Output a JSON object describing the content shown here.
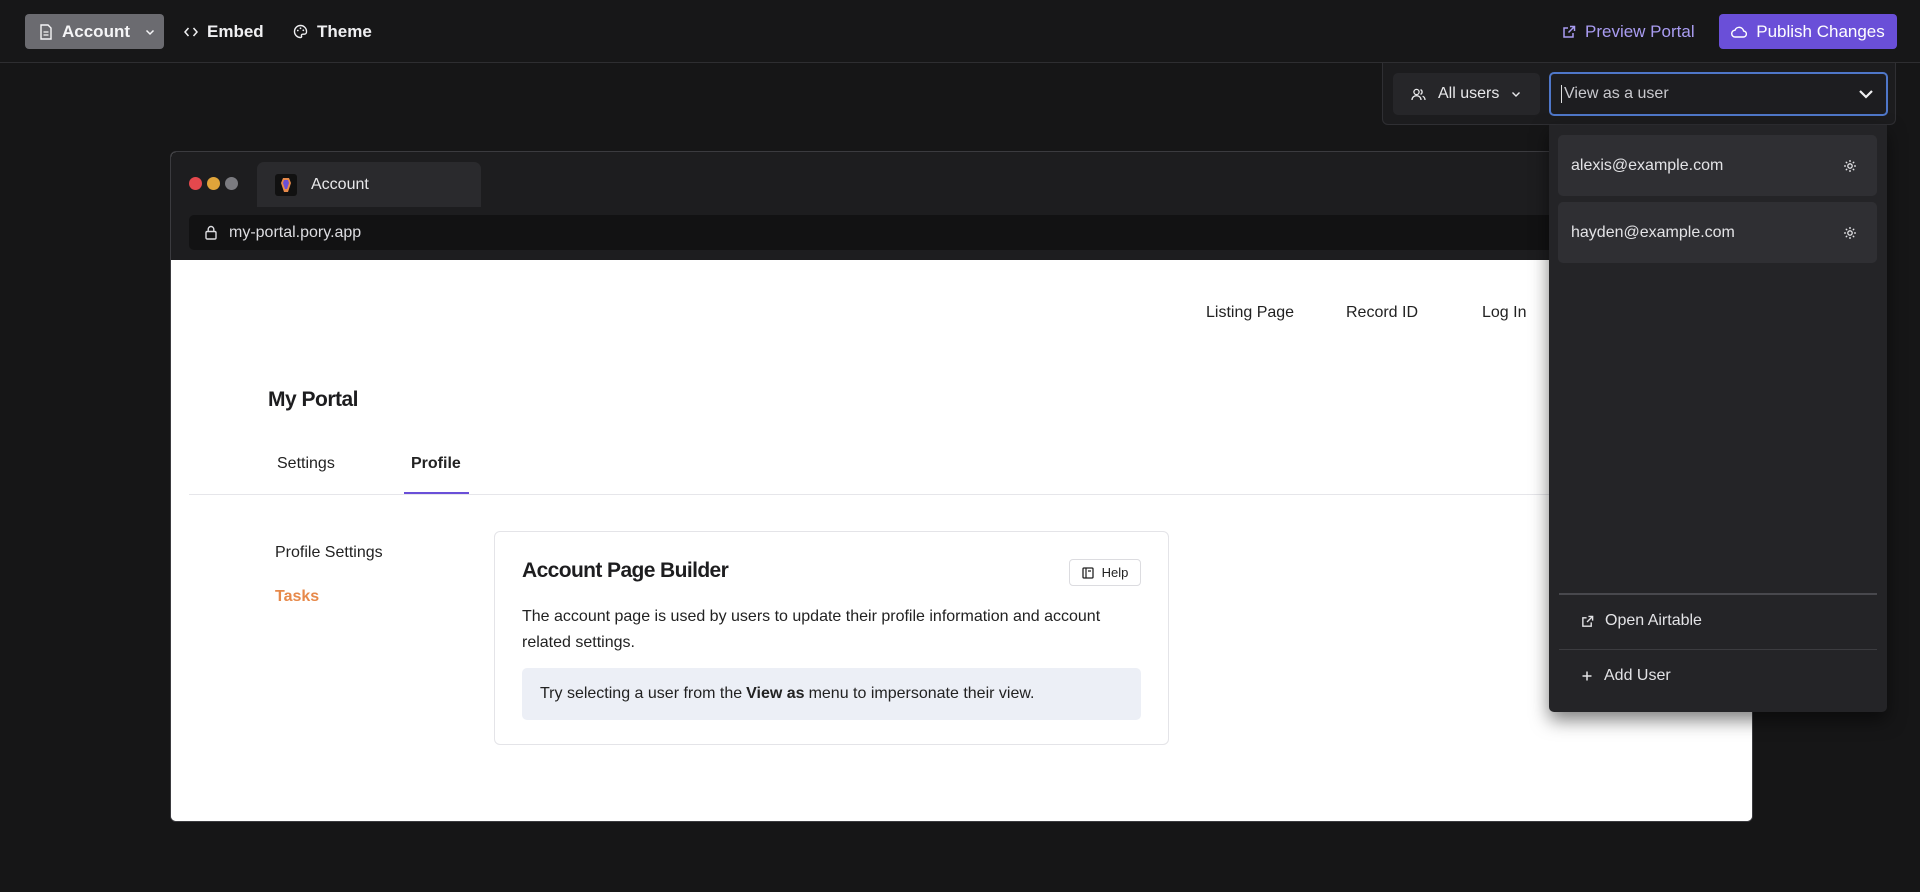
{
  "topbar": {
    "account_label": "Account",
    "embed_label": "Embed",
    "theme_label": "Theme",
    "preview_label": "Preview Portal",
    "publish_label": "Publish Changes"
  },
  "browser": {
    "tab_title": "Account",
    "url": "my-portal.pory.app",
    "window_dot_colors": [
      "#e5484d",
      "#e0a43a",
      "#7b7b80"
    ]
  },
  "site": {
    "nav": [
      "Listing Page",
      "Record ID",
      "Log In"
    ],
    "portal_title": "My Portal",
    "tabs": [
      {
        "label": "Settings",
        "active": false
      },
      {
        "label": "Profile",
        "active": true
      }
    ],
    "sidebar": [
      {
        "label": "Profile Settings",
        "active": false
      },
      {
        "label": "Tasks",
        "active": true
      }
    ],
    "card": {
      "title": "Account Page Builder",
      "help_label": "Help",
      "description": "The account page is used by users to update their profile information and account related settings.",
      "tip_before": "Try selecting a user from the",
      "tip_bold": "View as",
      "tip_after": "menu to impersonate their view."
    }
  },
  "viewas": {
    "filter_label": "All users",
    "placeholder": "View as a user",
    "users": [
      "alexis@example.com",
      "hayden@example.com"
    ],
    "open_airtable_label": "Open Airtable",
    "add_user_label": "Add User"
  },
  "colors": {
    "accent": "#6a4fd8",
    "accent_text": "#a99cf1",
    "active_sidebar": "#e7894a",
    "focus_border": "#4f77c9"
  }
}
